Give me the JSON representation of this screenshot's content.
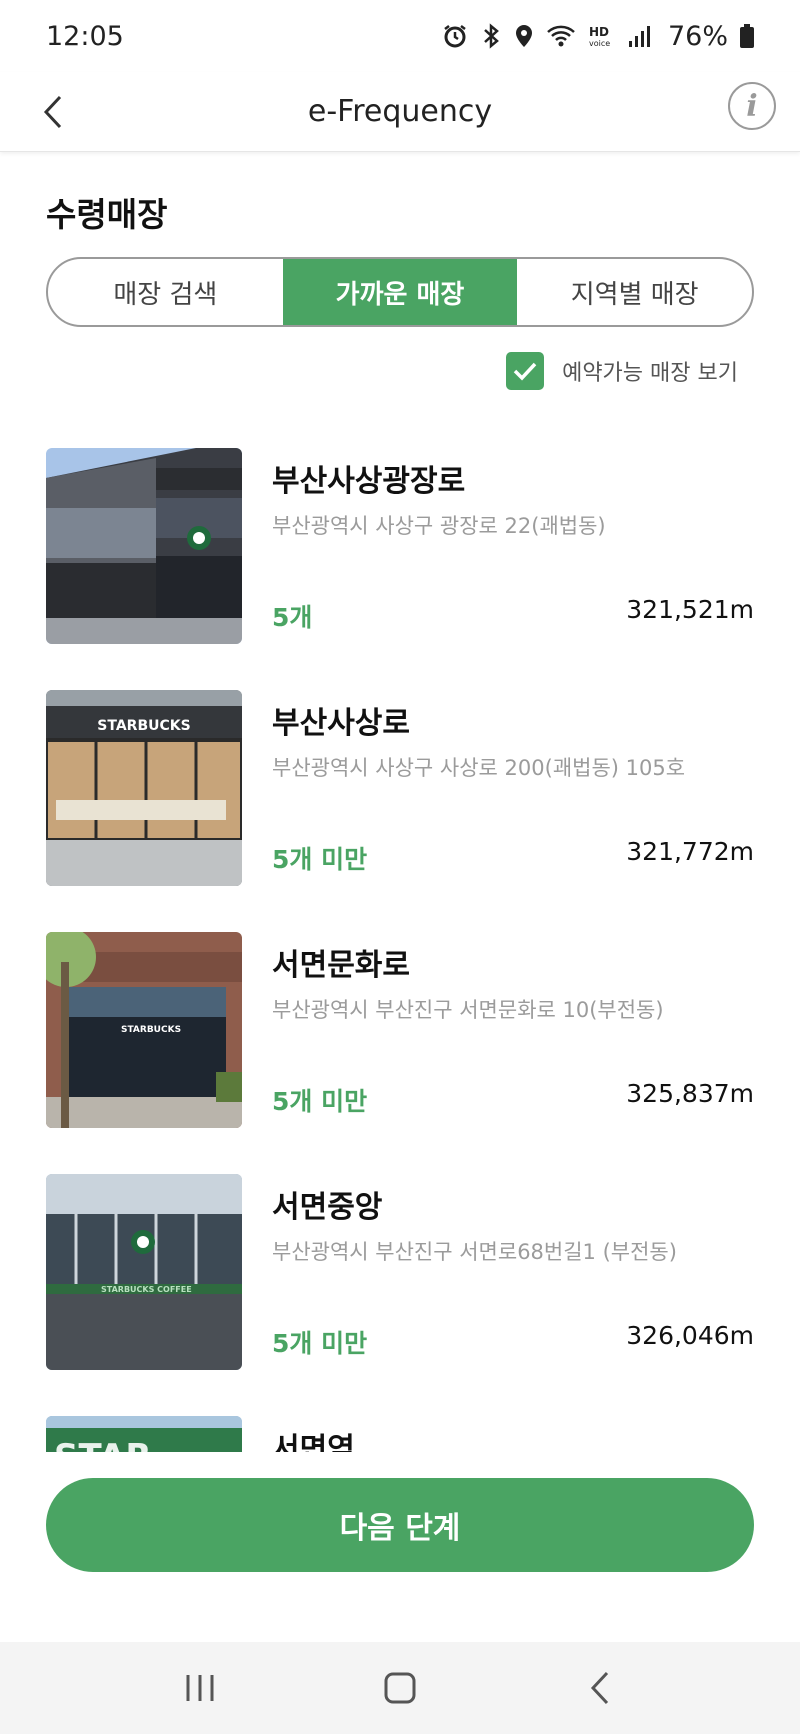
{
  "status_bar": {
    "time": "12:05",
    "battery": "76%",
    "icons": [
      "alarm-icon",
      "bluetooth-icon",
      "location-icon",
      "wifi-icon",
      "hd-voice-icon",
      "signal-icon",
      "battery-icon"
    ]
  },
  "app_bar": {
    "title": "e-Frequency",
    "info_label": "i"
  },
  "section_title": "수령매장",
  "tabs": [
    {
      "label": "매장 검색",
      "active": false
    },
    {
      "label": "가까운 매장",
      "active": true
    },
    {
      "label": "지역별 매장",
      "active": false
    }
  ],
  "filter": {
    "label": "예약가능 매장 보기",
    "checked": true
  },
  "stores": [
    {
      "name": "부산사상광장로",
      "address": "부산광역시 사상구 광장로 22(괘법동)",
      "count": "5개",
      "distance": "321,521m"
    },
    {
      "name": "부산사상로",
      "address": "부산광역시 사상구 사상로 200(괘법동) 105호",
      "count": "5개 미만",
      "distance": "321,772m"
    },
    {
      "name": "서면문화로",
      "address": "부산광역시 부산진구 서면문화로 10(부전동)",
      "count": "5개 미만",
      "distance": "325,837m"
    },
    {
      "name": "서면중앙",
      "address": "부산광역시 부산진구 서면로68번길1 (부전동)",
      "count": "5개 미만",
      "distance": "326,046m"
    },
    {
      "name": "서면역",
      "address": "",
      "count": "",
      "distance": ""
    }
  ],
  "store_image_text": [
    "STARBUCKS",
    "STARBUCKS",
    "STARBUCKS COFFEE",
    "STAR"
  ],
  "next_button": "다음 단계",
  "nav": {
    "icons": [
      "recent-apps-icon",
      "home-icon",
      "back-icon"
    ]
  },
  "colors": {
    "accent": "#4aa463",
    "text_primary": "#111111",
    "text_secondary": "#9b9b9b"
  }
}
